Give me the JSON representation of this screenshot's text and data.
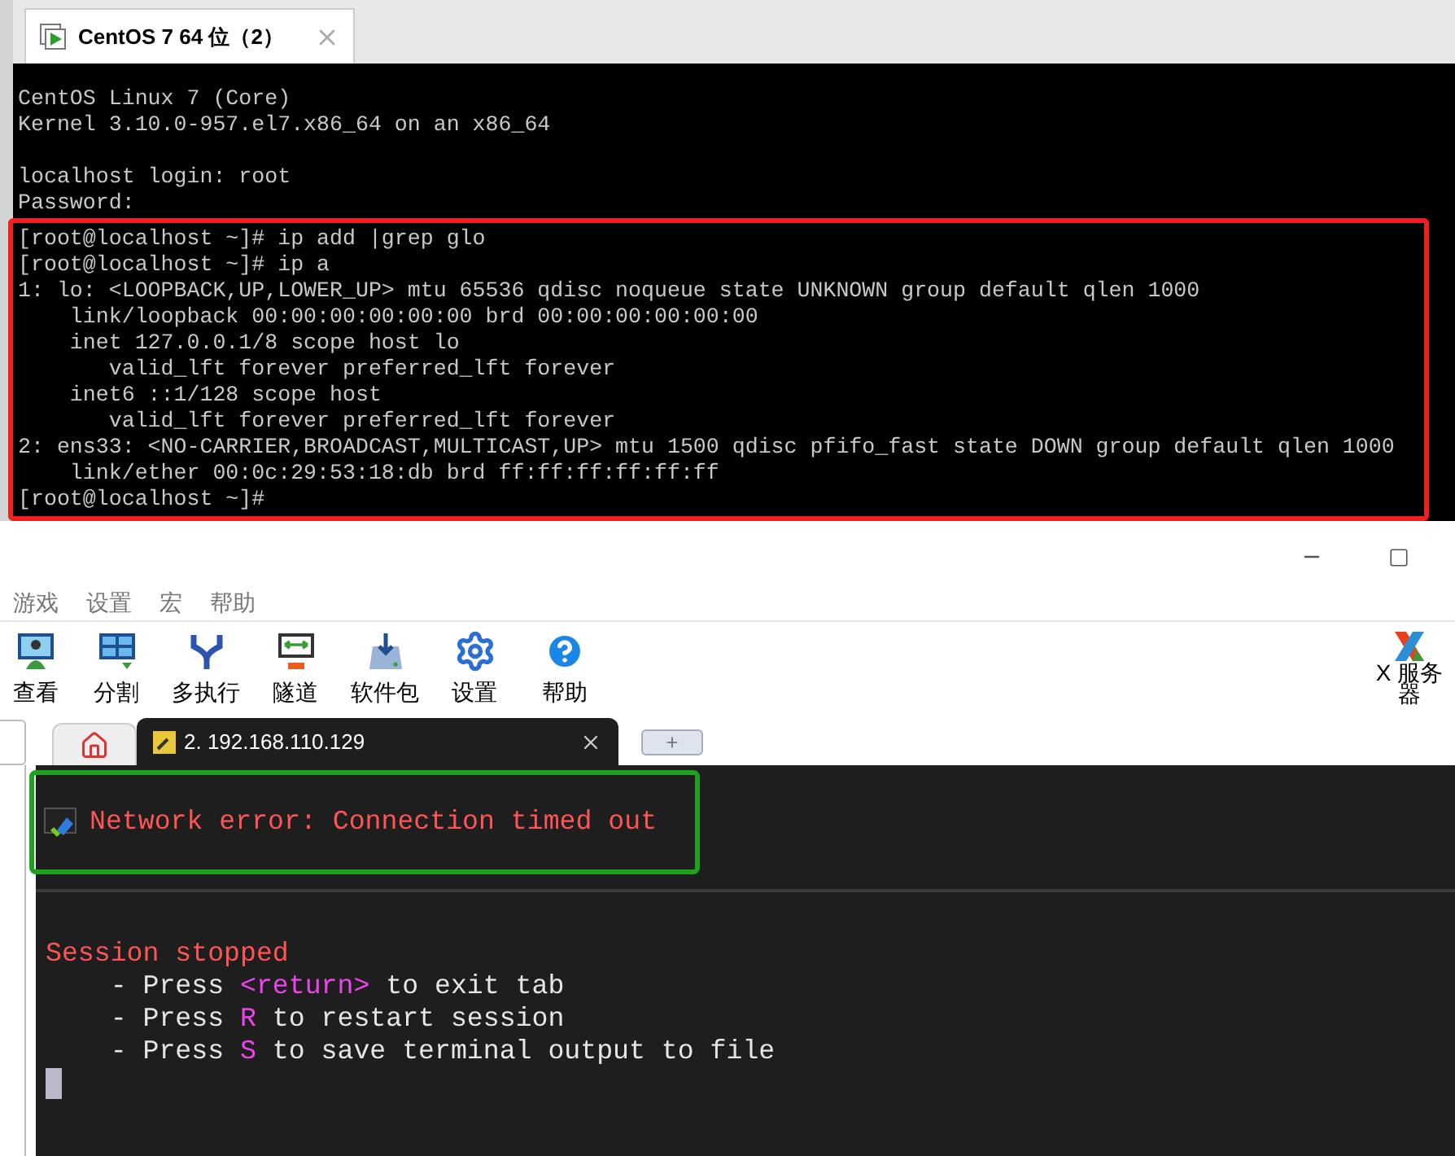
{
  "vm_window": {
    "tab": {
      "title": "CentOS 7 64 位（2）",
      "selected": true
    },
    "console": {
      "banner_lines": [
        "CentOS Linux 7 (Core)",
        "Kernel 3.10.0-957.el7.x86_64 on an x86_64"
      ],
      "login_lines": [
        "localhost login: root",
        "Password:"
      ],
      "highlighted_lines": [
        "[root@localhost ~]# ip add |grep glo",
        "[root@localhost ~]# ip a",
        "1: lo: <LOOPBACK,UP,LOWER_UP> mtu 65536 qdisc noqueue state UNKNOWN group default qlen 1000",
        "    link/loopback 00:00:00:00:00:00 brd 00:00:00:00:00:00",
        "    inet 127.0.0.1/8 scope host lo",
        "       valid_lft forever preferred_lft forever",
        "    inet6 ::1/128 scope host",
        "       valid_lft forever preferred_lft forever",
        "2: ens33: <NO-CARRIER,BROADCAST,MULTICAST,UP> mtu 1500 qdisc pfifo_fast state DOWN group default qlen 1000",
        "    link/ether 00:0c:29:53:18:db brd ff:ff:ff:ff:ff:ff",
        "[root@localhost ~]#"
      ]
    }
  },
  "ssh_client": {
    "menu": [
      "游戏",
      "设置",
      "宏",
      "帮助"
    ],
    "toolbar": [
      {
        "label": "查看"
      },
      {
        "label": "分割"
      },
      {
        "label": "多执行"
      },
      {
        "label": "隧道"
      },
      {
        "label": "软件包"
      },
      {
        "label": "设置"
      },
      {
        "label": "帮助"
      }
    ],
    "x_server": {
      "label": "X 服务器"
    },
    "tabs": [
      {
        "kind": "home",
        "selected": false
      },
      {
        "kind": "session",
        "label": "2. 192.168.110.129",
        "selected": true
      }
    ],
    "terminal": {
      "error": "Network error: Connection timed out",
      "status": "Session stopped",
      "hints": [
        [
          {
            "kind": "plain",
            "text": "    - Press "
          },
          {
            "kind": "key",
            "text": "<return>"
          },
          {
            "kind": "plain",
            "text": " to exit tab"
          }
        ],
        [
          {
            "kind": "plain",
            "text": "    - Press "
          },
          {
            "kind": "key",
            "text": "R"
          },
          {
            "kind": "plain",
            "text": " to restart session"
          }
        ],
        [
          {
            "kind": "plain",
            "text": "    - Press "
          },
          {
            "kind": "key",
            "text": "S"
          },
          {
            "kind": "plain",
            "text": " to save terminal output to file"
          }
        ]
      ]
    }
  }
}
